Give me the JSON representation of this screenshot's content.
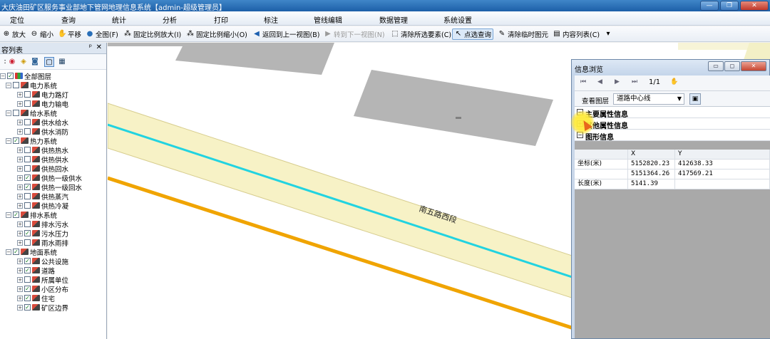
{
  "app": {
    "title": "大庆油田矿区服务事业部地下管网地理信息系统【admin-超级管理员】"
  },
  "menu": [
    "定位",
    "查询",
    "统计",
    "分析",
    "打印",
    "标注",
    "管线编辑",
    "数据管理",
    "系统设置"
  ],
  "toolbar": {
    "zoom_in": "放大",
    "zoom_out": "缩小",
    "pan": "平移",
    "full_extent": "全图(F)",
    "fixed_zoom_in": "固定比例放大(I)",
    "fixed_zoom_out": "固定比例缩小(O)",
    "prev_view": "返回到上一视图(B)",
    "next_view": "转到下一视图(N)",
    "clear_selection": "清除所选要素(C)",
    "point_query": "点选查询",
    "clear_temp": "清除临时图元",
    "content_list": "内容列表(C)"
  },
  "layer_panel": {
    "title": "容列表",
    "root": "全部图层",
    "groups": [
      {
        "name": "电力系统",
        "checked": false,
        "items": [
          {
            "name": "电力路灯",
            "checked": false
          },
          {
            "name": "电力输电",
            "checked": false
          }
        ]
      },
      {
        "name": "给水系统",
        "checked": false,
        "items": [
          {
            "name": "供水给水",
            "checked": false
          },
          {
            "name": "供水消防",
            "checked": false
          }
        ]
      },
      {
        "name": "热力系统",
        "checked": true,
        "items": [
          {
            "name": "供热热水",
            "checked": false
          },
          {
            "name": "供热供水",
            "checked": false
          },
          {
            "name": "供热回水",
            "checked": false
          },
          {
            "name": "供热一级供水",
            "checked": true
          },
          {
            "name": "供热一级回水",
            "checked": true
          },
          {
            "name": "供热蒸汽",
            "checked": false
          },
          {
            "name": "供热冷凝",
            "checked": false
          }
        ]
      },
      {
        "name": "排水系统",
        "checked": true,
        "items": [
          {
            "name": "排水污水",
            "checked": false
          },
          {
            "name": "污水压力",
            "checked": true
          },
          {
            "name": "雨水雨排",
            "checked": false
          }
        ]
      },
      {
        "name": "地面系统",
        "checked": true,
        "items": [
          {
            "name": "公共设施",
            "checked": true
          },
          {
            "name": "道路",
            "checked": true
          },
          {
            "name": "所属单位",
            "checked": false
          },
          {
            "name": "小区分布",
            "checked": true
          },
          {
            "name": "住宅",
            "checked": true
          },
          {
            "name": "矿区边界",
            "checked": true
          }
        ]
      }
    ]
  },
  "map": {
    "road_label": "南五路西段"
  },
  "info_window": {
    "title": "信息浏览",
    "page": "1/1",
    "layer_label": "查看图层",
    "layer_value": "道路中心线",
    "sections": [
      "主要属性信息",
      "其他属性信息",
      "图形信息"
    ],
    "table": {
      "headers": [
        "",
        "X",
        "Y"
      ],
      "rows": [
        [
          "坐标(米)",
          "5152820.23",
          "412638.33"
        ],
        [
          "",
          "5151364.26",
          "417569.21"
        ],
        [
          "长度(米)",
          "5141.39",
          ""
        ]
      ]
    }
  }
}
